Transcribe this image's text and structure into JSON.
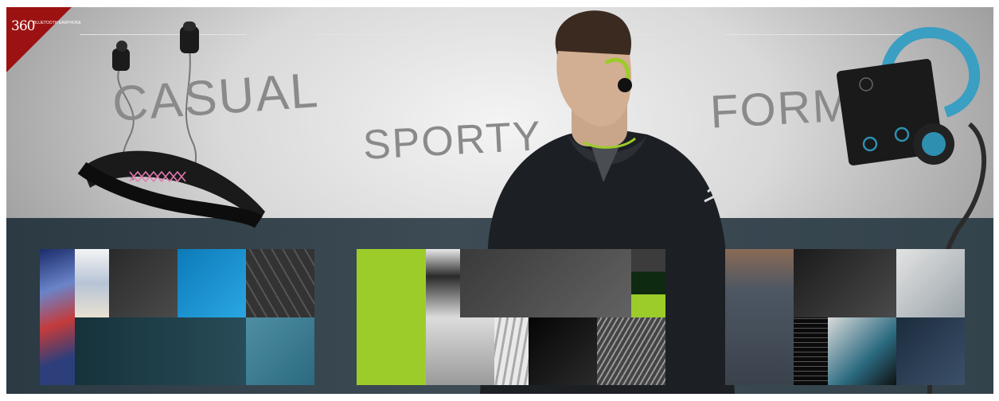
{
  "brand": {
    "logo_number": "360",
    "logo_text": "BLUETOOTH EARPHONE"
  },
  "categories": [
    {
      "label": "CASUAL"
    },
    {
      "label": "SPORTY"
    },
    {
      "label": "FORMAL"
    }
  ],
  "colors": {
    "accent_red": "#9c1212",
    "sport_green": "#9ccc2a",
    "formal_teal": "#2e8fb0",
    "band": "#33434c"
  }
}
